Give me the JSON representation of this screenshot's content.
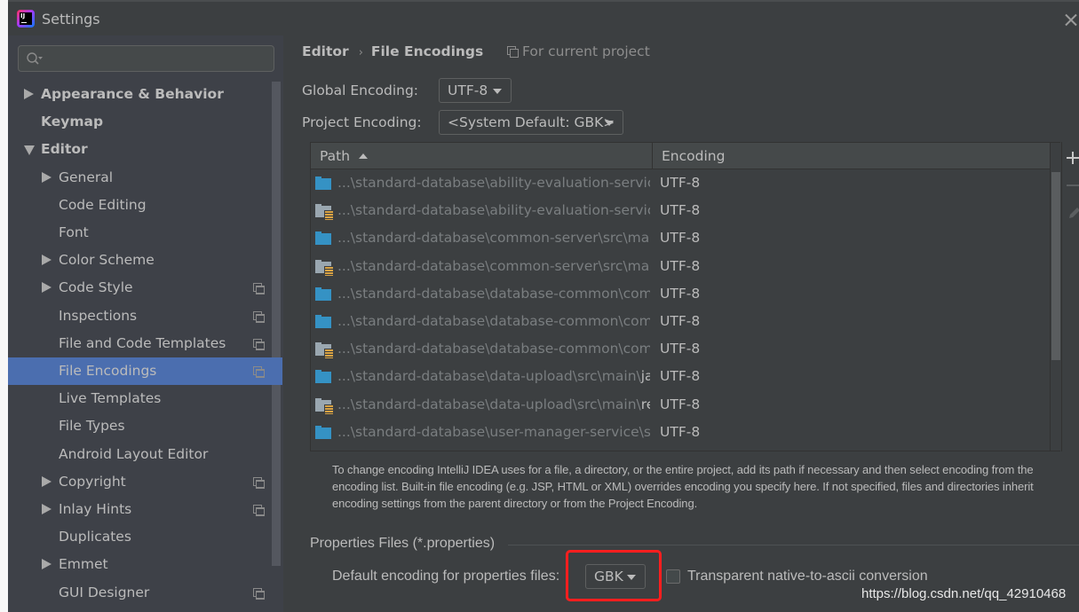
{
  "window": {
    "title": "Settings",
    "logo_text": "IJ"
  },
  "sidebar": {
    "search": {
      "placeholder": "",
      "value": ""
    },
    "items": [
      {
        "label": "Appearance & Behavior",
        "level": 0,
        "expandable": true,
        "expanded": false,
        "bold": true,
        "project_scoped": false,
        "selected": false
      },
      {
        "label": "Keymap",
        "level": 0,
        "expandable": false,
        "bold": true,
        "project_scoped": false,
        "selected": false
      },
      {
        "label": "Editor",
        "level": 0,
        "expandable": true,
        "expanded": true,
        "bold": true,
        "project_scoped": false,
        "selected": false
      },
      {
        "label": "General",
        "level": 1,
        "expandable": true,
        "expanded": false,
        "project_scoped": false,
        "selected": false
      },
      {
        "label": "Code Editing",
        "level": 1,
        "expandable": false,
        "project_scoped": false,
        "selected": false
      },
      {
        "label": "Font",
        "level": 1,
        "expandable": false,
        "project_scoped": false,
        "selected": false
      },
      {
        "label": "Color Scheme",
        "level": 1,
        "expandable": true,
        "expanded": false,
        "project_scoped": false,
        "selected": false
      },
      {
        "label": "Code Style",
        "level": 1,
        "expandable": true,
        "expanded": false,
        "project_scoped": true,
        "selected": false
      },
      {
        "label": "Inspections",
        "level": 1,
        "expandable": false,
        "project_scoped": true,
        "selected": false
      },
      {
        "label": "File and Code Templates",
        "level": 1,
        "expandable": false,
        "project_scoped": true,
        "selected": false
      },
      {
        "label": "File Encodings",
        "level": 1,
        "expandable": false,
        "project_scoped": true,
        "selected": true
      },
      {
        "label": "Live Templates",
        "level": 1,
        "expandable": false,
        "project_scoped": false,
        "selected": false
      },
      {
        "label": "File Types",
        "level": 1,
        "expandable": false,
        "project_scoped": false,
        "selected": false
      },
      {
        "label": "Android Layout Editor",
        "level": 1,
        "expandable": false,
        "project_scoped": false,
        "selected": false
      },
      {
        "label": "Copyright",
        "level": 1,
        "expandable": true,
        "expanded": false,
        "project_scoped": true,
        "selected": false
      },
      {
        "label": "Inlay Hints",
        "level": 1,
        "expandable": true,
        "expanded": false,
        "project_scoped": true,
        "selected": false
      },
      {
        "label": "Duplicates",
        "level": 1,
        "expandable": false,
        "project_scoped": false,
        "selected": false
      },
      {
        "label": "Emmet",
        "level": 1,
        "expandable": true,
        "expanded": false,
        "project_scoped": false,
        "selected": false
      },
      {
        "label": "GUI Designer",
        "level": 1,
        "expandable": false,
        "project_scoped": true,
        "selected": false
      }
    ]
  },
  "main": {
    "breadcrumb": [
      "Editor",
      "File Encodings"
    ],
    "breadcrumb_separator": "›",
    "scope_note": "For current project",
    "global_encoding": {
      "label": "Global Encoding:",
      "value": "UTF-8"
    },
    "project_encoding": {
      "label": "Project Encoding:",
      "value": "<System Default: GBK>"
    },
    "table": {
      "columns": [
        {
          "label": "Path",
          "sort": "ascending"
        },
        {
          "label": "Encoding"
        }
      ],
      "rows": [
        {
          "icon": "source-folder-icon",
          "path_dim": "...\\standard-database\\ability-evaluation-service\\s",
          "path_bright": "",
          "encoding": "UTF-8"
        },
        {
          "icon": "resources-folder-icon",
          "path_dim": "...\\standard-database\\ability-evaluation-service\\s",
          "path_bright": "",
          "encoding": "UTF-8"
        },
        {
          "icon": "source-folder-icon",
          "path_dim": "...\\standard-database\\common-server\\src\\main\\",
          "path_bright": "",
          "encoding": "UTF-8"
        },
        {
          "icon": "resources-folder-icon",
          "path_dim": "...\\standard-database\\common-server\\src\\main\\",
          "path_bright": "",
          "encoding": "UTF-8"
        },
        {
          "icon": "source-folder-icon",
          "path_dim": "...\\standard-database\\database-common\\commc",
          "path_bright": "",
          "encoding": "UTF-8"
        },
        {
          "icon": "source-folder-icon",
          "path_dim": "...\\standard-database\\database-common\\commc",
          "path_bright": "",
          "encoding": "UTF-8"
        },
        {
          "icon": "resources-folder-icon",
          "path_dim": "...\\standard-database\\database-common\\commc",
          "path_bright": "",
          "encoding": "UTF-8"
        },
        {
          "icon": "source-folder-icon",
          "path_dim": "...\\standard-database\\data-upload\\src\\main\\",
          "path_bright": "java",
          "encoding": "UTF-8"
        },
        {
          "icon": "resources-folder-icon",
          "path_dim": "...\\standard-database\\data-upload\\src\\main\\",
          "path_bright": "reso",
          "encoding": "UTF-8"
        },
        {
          "icon": "source-folder-icon",
          "path_dim": "...\\standard-database\\user-manager-service\\src\\r",
          "path_bright": "",
          "encoding": "UTF-8"
        }
      ],
      "toolbar": [
        "add-icon",
        "remove-icon",
        "edit-icon"
      ]
    },
    "hint": "To change encoding IntelliJ IDEA uses for a file, a directory, or the entire project, add its path if necessary and then select encoding from the encoding list. Built-in file encoding (e.g. JSP, HTML or XML) overrides encoding you specify here. If not specified, files and directories inherit encoding settings from the parent directory or from the Project Encoding.",
    "properties": {
      "group_title": "Properties Files (*.properties)",
      "default_label": "Default encoding for properties files:",
      "default_value": "GBK",
      "transparent_label": "Transparent native-to-ascii conversion",
      "transparent_checked": false
    }
  },
  "annotation": {
    "highlight_color": "#ff1e1e"
  },
  "watermark": "https://blog.csdn.net/qq_42910468",
  "colors": {
    "selection": "#4b6eaf",
    "source_folder": "#3592c4",
    "resources_folder": "#9aa7b0",
    "resources_badge": "#d9a343"
  }
}
